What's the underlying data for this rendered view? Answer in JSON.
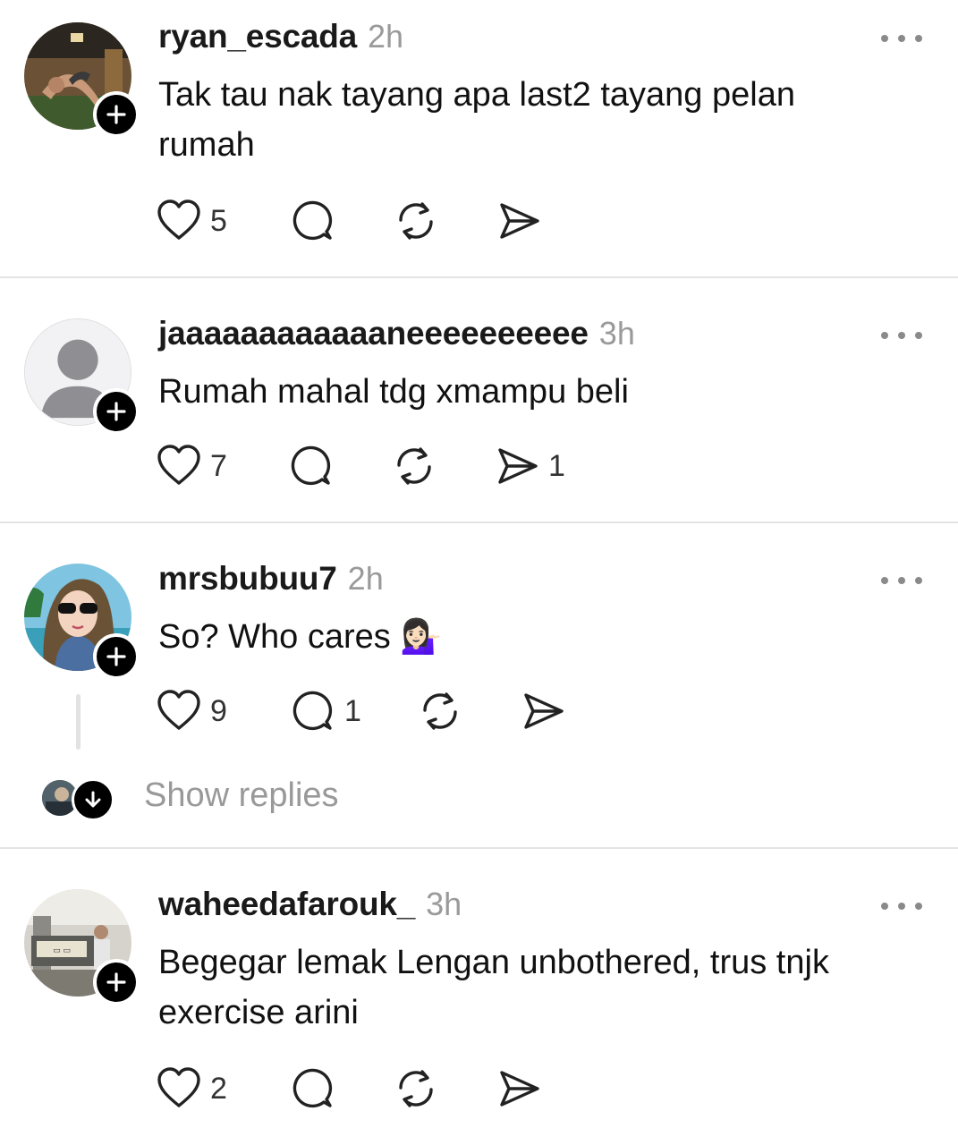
{
  "posts": [
    {
      "username": "ryan_escada",
      "time": "2h",
      "text_lines": [
        "Tak tau nak tayang apa last2 tayang pelan",
        "rumah"
      ],
      "likes": "5",
      "replies": "",
      "shares": "",
      "avatar_icon": "person-workout-photo-icon"
    },
    {
      "username": "jaaaaaaaaaaaaneeeeeeeeee",
      "time": "3h",
      "text_lines": [
        "Rumah mahal tdg xmampu beli"
      ],
      "likes": "7",
      "replies": "",
      "shares": "1",
      "avatar_icon": "default-user-silhouette-icon"
    },
    {
      "username": "mrsbubuu7",
      "time": "2h",
      "text_lines": [
        "So? Who cares 💁🏻‍♀️"
      ],
      "likes": "9",
      "replies": "1",
      "shares": "",
      "avatar_icon": "cartoon-woman-hijab-icon"
    },
    {
      "username": "waheedafarouk_",
      "time": "3h",
      "text_lines": [
        "Begegar lemak Lengan unbothered, trus tnjk",
        "exercise arini"
      ],
      "likes": "2",
      "replies": "",
      "shares": "",
      "avatar_icon": "street-stall-photo-icon"
    }
  ],
  "show_replies_label": "Show replies",
  "colors": {
    "background": "#ffffff",
    "username": "#1a1a1a",
    "timestamp": "#9a9a9a",
    "muted_text": "#999999",
    "badge": "#000000",
    "divider": "#e4e4e4"
  }
}
